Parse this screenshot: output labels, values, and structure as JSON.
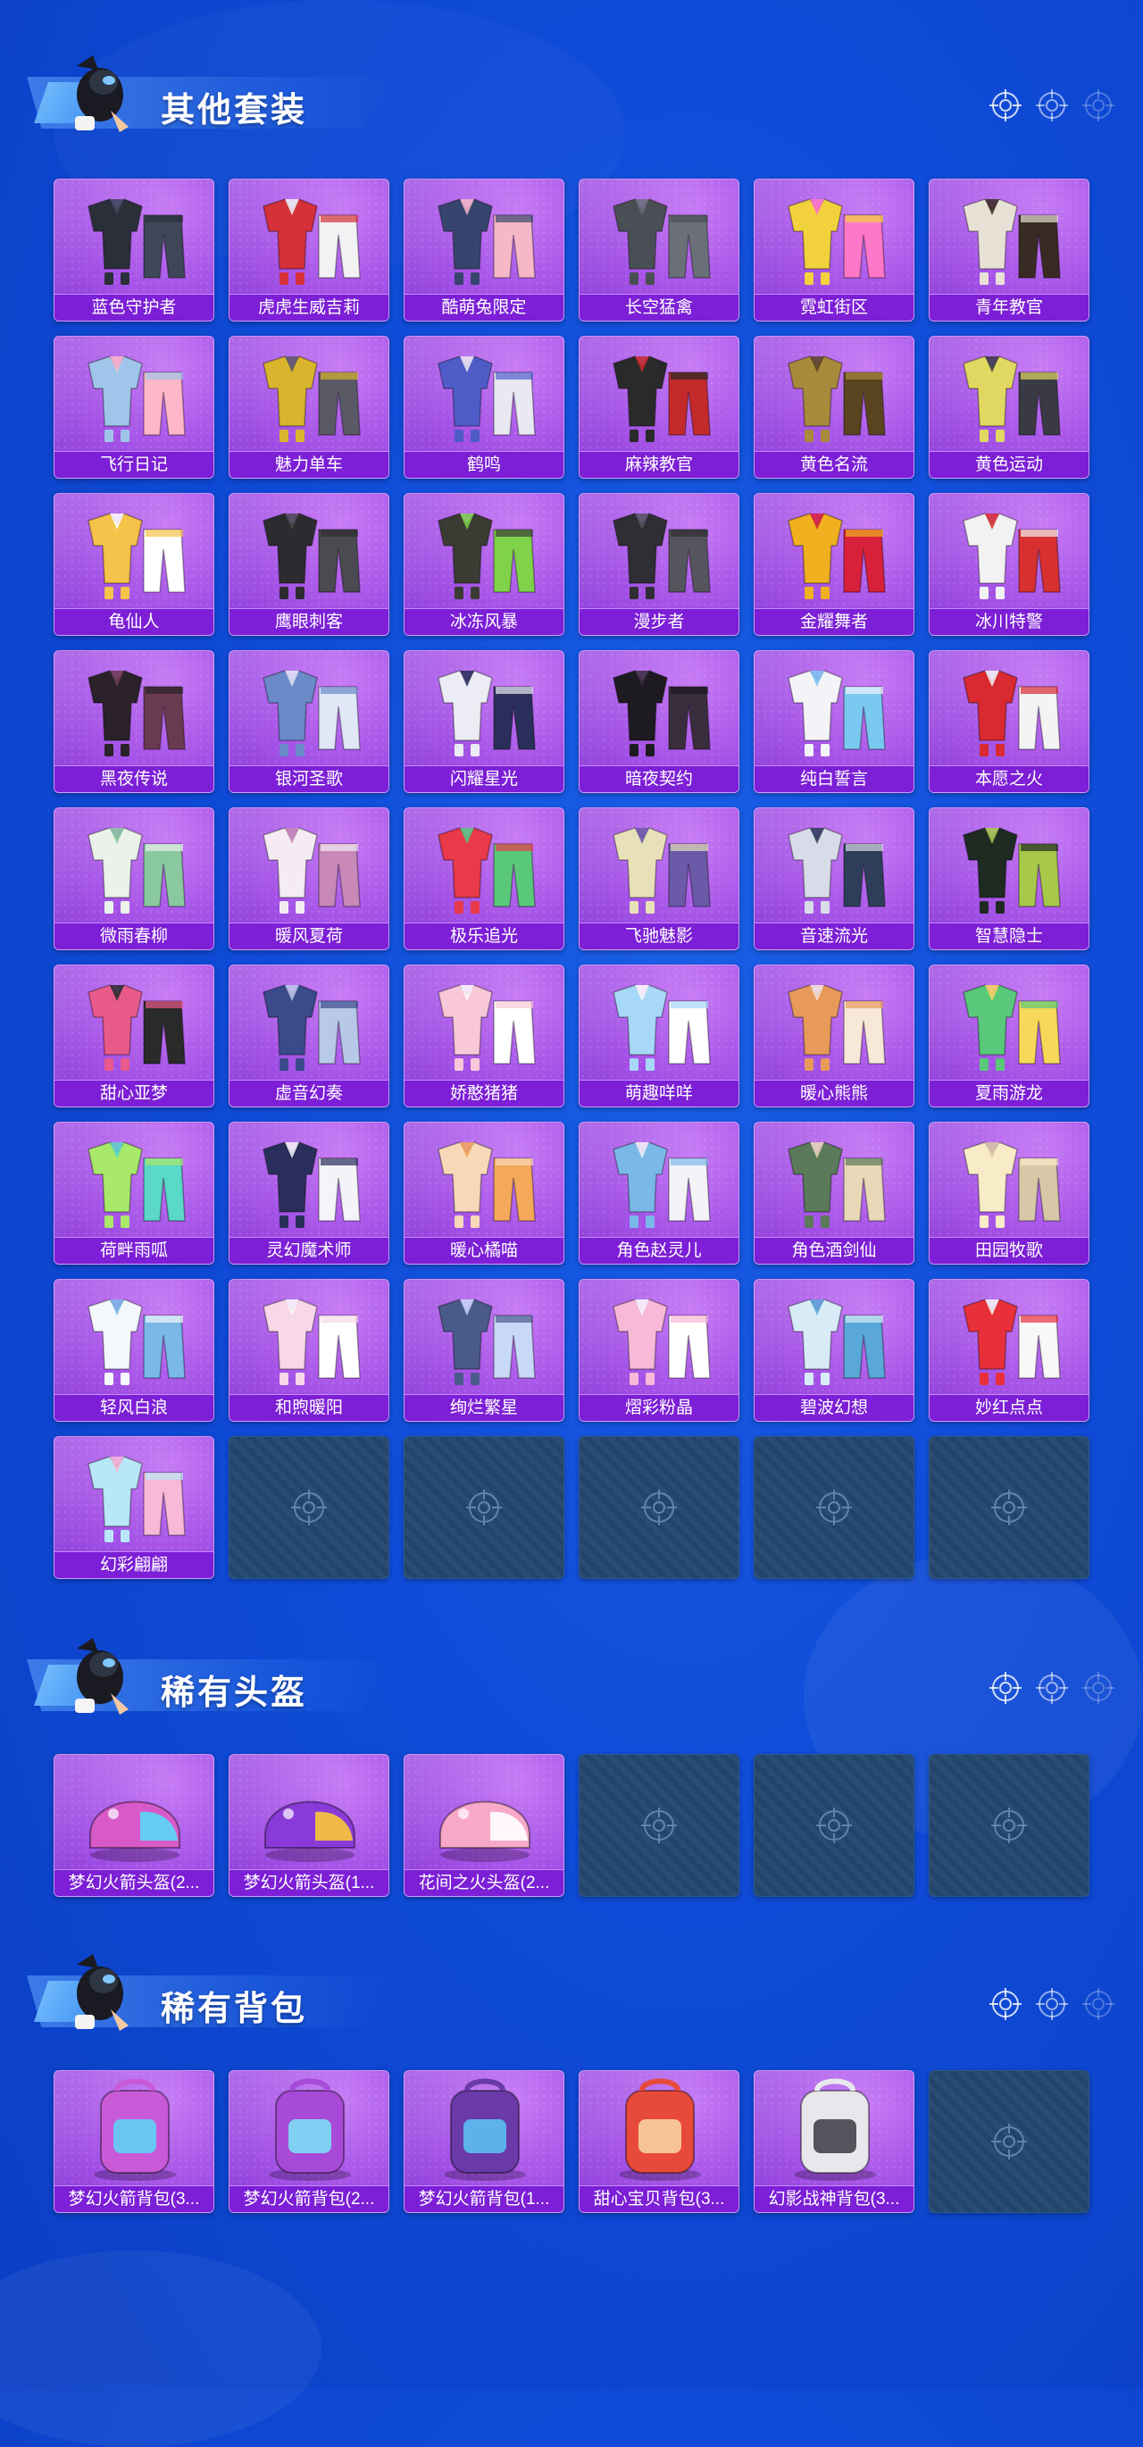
{
  "sections": [
    {
      "title": "其他套装",
      "items": [
        {
          "name": "蓝色守护者",
          "color": "#2b2f3a",
          "accent": "#3e4658"
        },
        {
          "name": "虎虎生威吉莉",
          "color": "#d6303a",
          "accent": "#f2f2f2"
        },
        {
          "name": "酷萌兔限定",
          "color": "#37456e",
          "accent": "#f6b8c8"
        },
        {
          "name": "长空猛禽",
          "color": "#4a4f55",
          "accent": "#6b7078"
        },
        {
          "name": "霓虹街区",
          "color": "#f2d23c",
          "accent": "#ff77c8"
        },
        {
          "name": "青年教官",
          "color": "#e8e2d6",
          "accent": "#3a2a24"
        },
        {
          "name": "飞行日记",
          "color": "#9fc6ea",
          "accent": "#ffb6c8"
        },
        {
          "name": "魅力单车",
          "color": "#d8b52c",
          "accent": "#5a5a66"
        },
        {
          "name": "鹤鸣",
          "color": "#4f5cc8",
          "accent": "#e9e9f2"
        },
        {
          "name": "麻辣教官",
          "color": "#2a2a2a",
          "accent": "#c42a2a"
        },
        {
          "name": "黄色名流",
          "color": "#a88a3c",
          "accent": "#5a4420"
        },
        {
          "name": "黄色运动",
          "color": "#e0d860",
          "accent": "#3a3a44"
        },
        {
          "name": "龟仙人",
          "color": "#f5c24a",
          "accent": "#ffffff"
        },
        {
          "name": "鹰眼刺客",
          "color": "#2c2c30",
          "accent": "#4a4a50"
        },
        {
          "name": "冰冻风暴",
          "color": "#3a3c34",
          "accent": "#7fd24a"
        },
        {
          "name": "漫步者",
          "color": "#2e2e34",
          "accent": "#55555e"
        },
        {
          "name": "金耀舞者",
          "color": "#f0b020",
          "accent": "#d8203a"
        },
        {
          "name": "冰川特警",
          "color": "#f2f2f2",
          "accent": "#d83030"
        },
        {
          "name": "黑夜传说",
          "color": "#2a2228",
          "accent": "#6a3a50"
        },
        {
          "name": "银河圣歌",
          "color": "#6a8ac8",
          "accent": "#e0e8f8"
        },
        {
          "name": "闪耀星光",
          "color": "#ececf4",
          "accent": "#2a2e5a"
        },
        {
          "name": "暗夜契约",
          "color": "#1e1a22",
          "accent": "#3a2e3e"
        },
        {
          "name": "纯白誓言",
          "color": "#f4f4f8",
          "accent": "#7ac8f0"
        },
        {
          "name": "本愿之火",
          "color": "#d82a30",
          "accent": "#f4f4f4"
        },
        {
          "name": "微雨春柳",
          "color": "#eaf2ea",
          "accent": "#8ac8a0"
        },
        {
          "name": "暖风夏荷",
          "color": "#f4ecf2",
          "accent": "#c888b8"
        },
        {
          "name": "极乐追光",
          "color": "#e83a48",
          "accent": "#5ac87a"
        },
        {
          "name": "飞驰魅影",
          "color": "#e8e0b8",
          "accent": "#6a5aa8"
        },
        {
          "name": "音速流光",
          "color": "#d8dce8",
          "accent": "#2e3e5a"
        },
        {
          "name": "智慧隐士",
          "color": "#1e2a22",
          "accent": "#a8c84a"
        },
        {
          "name": "甜心亚梦",
          "color": "#e85a8a",
          "accent": "#2a2a2a"
        },
        {
          "name": "虚音幻奏",
          "color": "#3a4a8a",
          "accent": "#b8c8e8"
        },
        {
          "name": "娇憨猪猪",
          "color": "#f8c8d8",
          "accent": "#ffffff"
        },
        {
          "name": "萌趣咩咩",
          "color": "#a8d8f8",
          "accent": "#ffffff"
        },
        {
          "name": "暖心熊熊",
          "color": "#e89a5a",
          "accent": "#f8e8d8"
        },
        {
          "name": "夏雨游龙",
          "color": "#5ac87a",
          "accent": "#f8d85a"
        },
        {
          "name": "荷畔雨呱",
          "color": "#a8e86a",
          "accent": "#5ad8c8"
        },
        {
          "name": "灵幻魔术师",
          "color": "#2a2e5a",
          "accent": "#f4f4f8"
        },
        {
          "name": "暖心橘喵",
          "color": "#f8d8b8",
          "accent": "#f4a85a"
        },
        {
          "name": "角色赵灵儿",
          "color": "#7ab8e8",
          "accent": "#f4f4f8"
        },
        {
          "name": "角色酒剑仙",
          "color": "#5a7a5a",
          "accent": "#e8d8b8"
        },
        {
          "name": "田园牧歌",
          "color": "#f8ecc8",
          "accent": "#d8c8a8"
        },
        {
          "name": "轻风白浪",
          "color": "#f4f8fc",
          "accent": "#7ab8e8"
        },
        {
          "name": "和煦暖阳",
          "color": "#f8d8e8",
          "accent": "#ffffff"
        },
        {
          "name": "绚烂繁星",
          "color": "#4a5a8a",
          "accent": "#c8d8f8"
        },
        {
          "name": "熠彩粉晶",
          "color": "#f8b8d8",
          "accent": "#ffffff"
        },
        {
          "name": "碧波幻想",
          "color": "#d8ecf8",
          "accent": "#5aa8d8"
        },
        {
          "name": "妙红点点",
          "color": "#e8303a",
          "accent": "#f8f8f8"
        },
        {
          "name": "幻彩翩翩",
          "color": "#b8e8f8",
          "accent": "#f8b8d8"
        }
      ],
      "empty_slots": 5
    },
    {
      "title": "稀有头盔",
      "items": [
        {
          "name": "梦幻火箭头盔(2...",
          "color": "#d85ac8",
          "accent": "#5ad8f8"
        },
        {
          "name": "梦幻火箭头盔(1...",
          "color": "#8a3ad8",
          "accent": "#f8c83a"
        },
        {
          "name": "花间之火头盔(2...",
          "color": "#f8a8c8",
          "accent": "#ffffff"
        }
      ],
      "empty_slots": 3
    },
    {
      "title": "稀有背包",
      "items": [
        {
          "name": "梦幻火箭背包(3...",
          "color": "#c85ad8",
          "accent": "#5ad8f8"
        },
        {
          "name": "梦幻火箭背包(2...",
          "color": "#a84ad8",
          "accent": "#7ae8f8"
        },
        {
          "name": "梦幻火箭背包(1...",
          "color": "#6a3aa8",
          "accent": "#5ac8f8"
        },
        {
          "name": "甜心宝贝背包(3...",
          "color": "#e84a3a",
          "accent": "#f8d8a8"
        },
        {
          "name": "幻影战神背包(3...",
          "color": "#e8e8ec",
          "accent": "#3a3a44"
        }
      ],
      "empty_slots": 1
    }
  ]
}
